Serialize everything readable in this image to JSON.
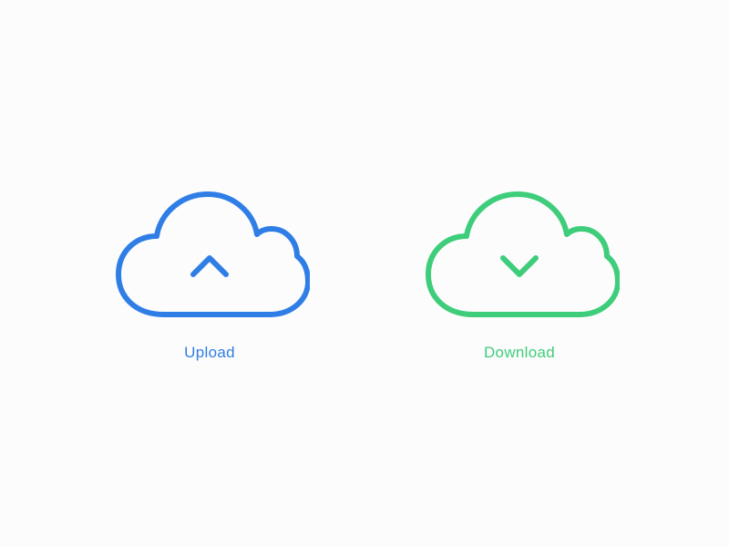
{
  "actions": {
    "upload": {
      "label": "Upload",
      "color": "#2f7ee6"
    },
    "download": {
      "label": "Download",
      "color": "#3ecd7b"
    }
  }
}
